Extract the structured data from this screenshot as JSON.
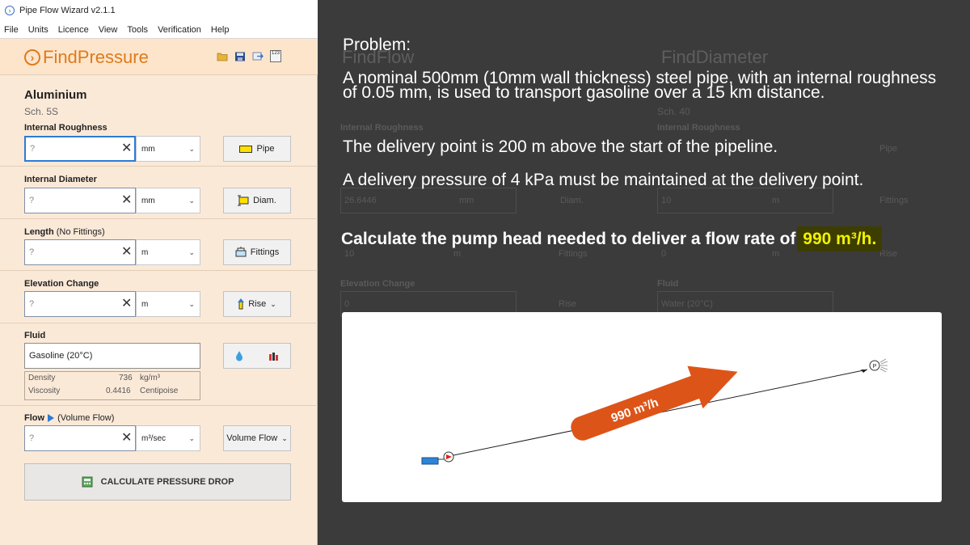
{
  "window": {
    "title": "Pipe Flow Wizard v2.1.1"
  },
  "menu": [
    "File",
    "Units",
    "Licence",
    "View",
    "Tools",
    "Verification",
    "Help"
  ],
  "header": {
    "title": "FindPressure",
    "calc_icon_text": "123"
  },
  "material": {
    "name": "Aluminium",
    "schedule": "Sch.  5S"
  },
  "fields": {
    "roughness": {
      "label": "Internal Roughness",
      "placeholder": "?",
      "unit": "mm",
      "button": "Pipe"
    },
    "diameter": {
      "label": "Internal Diameter",
      "placeholder": "?",
      "unit": "mm",
      "button": "Diam."
    },
    "length": {
      "label": "Length",
      "label_note": "(No Fittings)",
      "placeholder": "?",
      "unit": "m",
      "button": "Fittings"
    },
    "elevation": {
      "label": "Elevation Change",
      "placeholder": "?",
      "unit": "m",
      "button": "Rise"
    },
    "fluid": {
      "label": "Fluid",
      "value": "Gasoline (20°C)"
    },
    "flow": {
      "label": "Flow",
      "label_note": "(Volume Flow)",
      "placeholder": "?",
      "unit": "m³/sec",
      "button": "Volume Flow"
    }
  },
  "properties": {
    "density_label": "Density",
    "density_value": "736",
    "density_unit": "kg/m³",
    "viscosity_label": "Viscosity",
    "viscosity_value": "0.4416",
    "viscosity_unit": "Centipoise"
  },
  "calculate_button": "CALCULATE PRESSURE DROP",
  "background_app": {
    "title_left": "FindFlow",
    "title_right": "FindDiameter",
    "schedule": "Sch. 40",
    "roughness_label": "Internal Roughness",
    "diameter_value": "26.6446",
    "diameter_unit": "mm",
    "diameter_button": "Diam.",
    "length_value": "10",
    "length_unit": "m",
    "fittings_button": "Fittings",
    "elevation_label": "Elevation Change",
    "elevation_value": "0",
    "rise_button": "Rise",
    "right_roughness_label": "Internal Roughness",
    "right_pipe_button": "Pipe",
    "right_diameter_value": "10",
    "right_diameter_unit": "m",
    "right_fittings_button": "Fittings",
    "right_elevation_value": "0",
    "right_elevation_unit": "m",
    "right_rise_button": "Rise",
    "right_fluid_label": "Fluid",
    "right_fluid_value": "Water (20°C)"
  },
  "overlay": {
    "heading": "Problem:",
    "para1": "A nominal 500mm (10mm wall thickness) steel pipe, with an internal roughness of 0.05 mm, is used to transport gasoline over a 15 km distance.",
    "para2": "The delivery point is 200 m above the start of the pipeline.",
    "para3": "A delivery pressure of 4 kPa must be maintained at the delivery point.",
    "para4_prefix": "Calculate the pump head needed to deliver a flow rate of ",
    "para4_highlight": "990 m³/h."
  },
  "diagram": {
    "arrow_label": "990 m³/h",
    "pump_label": "P",
    "arrow_color": "#dd5419"
  }
}
